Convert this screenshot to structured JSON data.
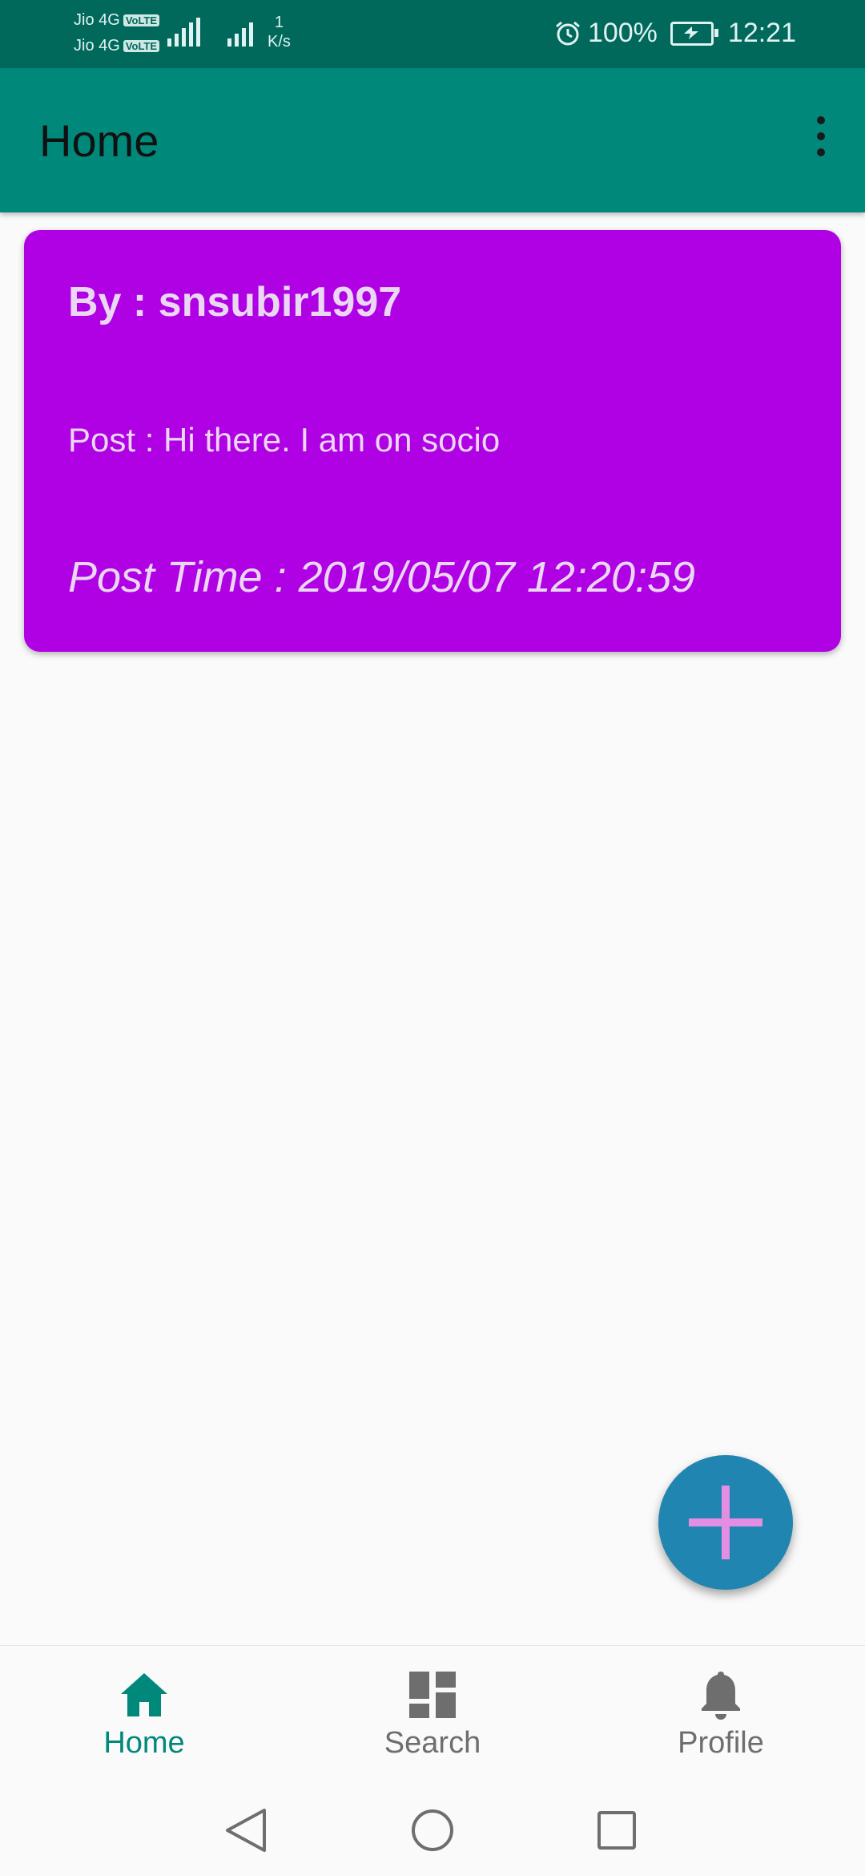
{
  "status_bar": {
    "carrier_1": "Jio 4G",
    "carrier_2": "Jio 4G",
    "volte_badge": "VoLTE",
    "net_speed_value": "1",
    "net_speed_unit": "K/s",
    "battery_percent": "100%",
    "time": "12:21",
    "icons": [
      "signal-icon",
      "alarm-icon",
      "battery-icon"
    ]
  },
  "app_bar": {
    "title": "Home",
    "menu_icon": "more-vert-icon",
    "background": "#00897b"
  },
  "posts": [
    {
      "author": "By : snsubir1997",
      "text": "Post : Hi there. I am on socio",
      "time": "Post Time : 2019/05/07 12:20:59",
      "background": "#b000e4"
    }
  ],
  "fab": {
    "icon": "add-icon",
    "background": "#2185b2",
    "icon_color": "#e28ee3"
  },
  "bottom_nav": {
    "items": [
      {
        "label": "Home",
        "icon": "home-icon",
        "active": true
      },
      {
        "label": "Search",
        "icon": "dashboard-icon",
        "active": false
      },
      {
        "label": "Profile",
        "icon": "bell-icon",
        "active": false
      }
    ],
    "active_color": "#00897b",
    "inactive_color": "#6e6e6e"
  },
  "system_nav": {
    "icons": [
      "back-icon",
      "home-circle-icon",
      "recents-icon"
    ]
  }
}
